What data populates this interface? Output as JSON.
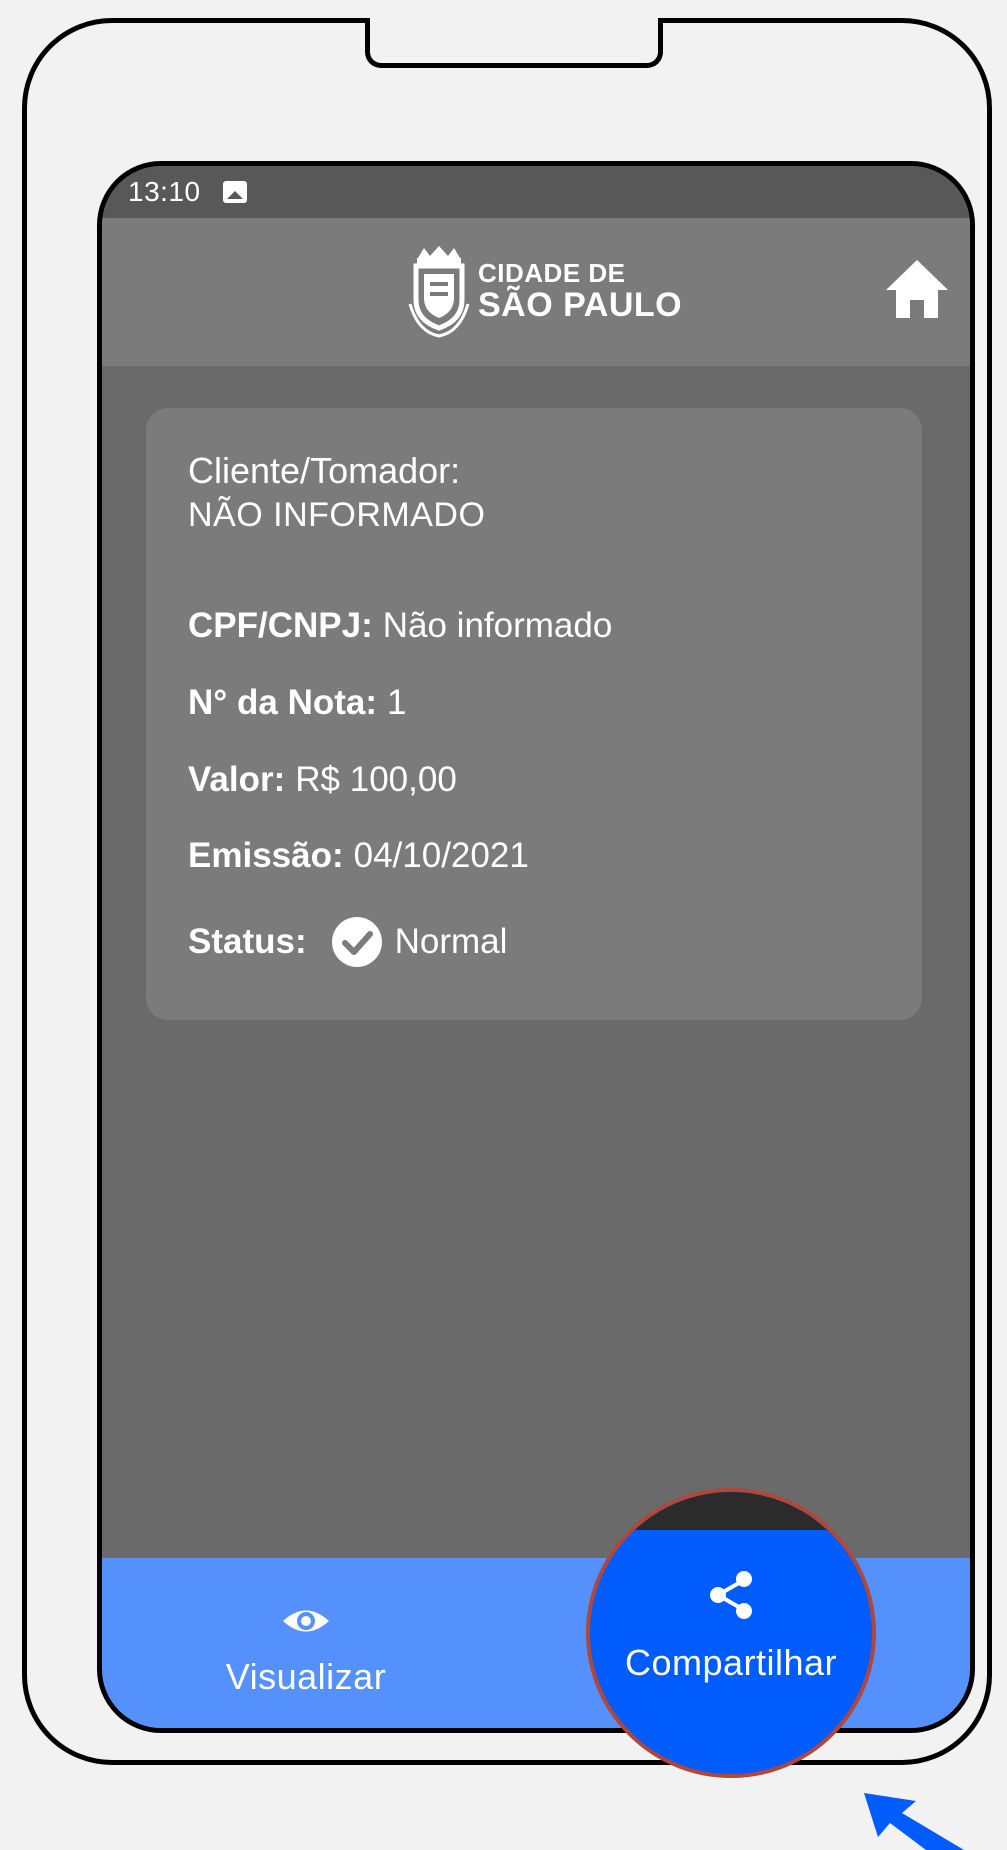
{
  "status_bar": {
    "time": "13:10",
    "notification_icon": "image-icon"
  },
  "app_bar": {
    "logo_line1": "CIDADE DE",
    "logo_line2": "SÃO PAULO",
    "home_icon": "home-icon"
  },
  "invoice": {
    "client_label": "Cliente/Tomador:",
    "client_value": "NÃO INFORMADO",
    "doc_label": "CPF/CNPJ:",
    "doc_value": "Não informado",
    "number_label": "N° da Nota:",
    "number_value": "1",
    "amount_label": "Valor:",
    "amount_value": "R$ 100,00",
    "issue_label": "Emissão:",
    "issue_value": "04/10/2021",
    "status_label": "Status:",
    "status_value": "Normal",
    "status_icon": "check-circle-icon"
  },
  "bottom_nav": {
    "view_label": "Visualizar",
    "view_icon": "eye-icon",
    "share_label": "Compartilhar",
    "share_icon": "share-icon"
  },
  "colors": {
    "nav_background": "#5591fd",
    "highlight": "#005cfc",
    "highlight_border": "#b0473a",
    "cursor": "#005cfc"
  }
}
